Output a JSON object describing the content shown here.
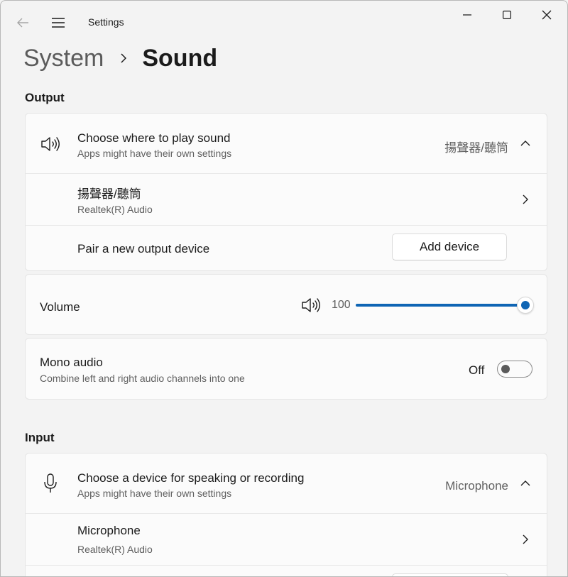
{
  "window": {
    "app_title": "Settings",
    "icons": [
      "back-arrow-icon",
      "hamburger-menu-icon",
      "minimize-icon",
      "maximize-icon",
      "close-icon"
    ]
  },
  "breadcrumb": {
    "parent": "System",
    "current": "Sound"
  },
  "output": {
    "section_title": "Output",
    "choose_device": {
      "title": "Choose where to play sound",
      "subtitle": "Apps might have their own settings",
      "selected": "揚聲器/聽筒"
    },
    "device": {
      "name": "揚聲器/聽筒",
      "driver": "Realtek(R) Audio"
    },
    "pair": {
      "label": "Pair a new output device",
      "button": "Add device"
    }
  },
  "volume": {
    "label": "Volume",
    "value": "100",
    "level": 1.0
  },
  "mono_audio": {
    "title": "Mono audio",
    "subtitle": "Combine left and right audio channels into one",
    "state": "Off"
  },
  "input": {
    "section_title": "Input",
    "choose_device": {
      "title": "Choose a device for speaking or recording",
      "subtitle": "Apps might have their own settings",
      "selected": "Microphone"
    },
    "device": {
      "name": "Microphone",
      "driver": "Realtek(R) Audio"
    }
  },
  "colors": {
    "accent": "#0f65b4",
    "background": "#f3f3f3",
    "card": "#fbfbfb"
  }
}
